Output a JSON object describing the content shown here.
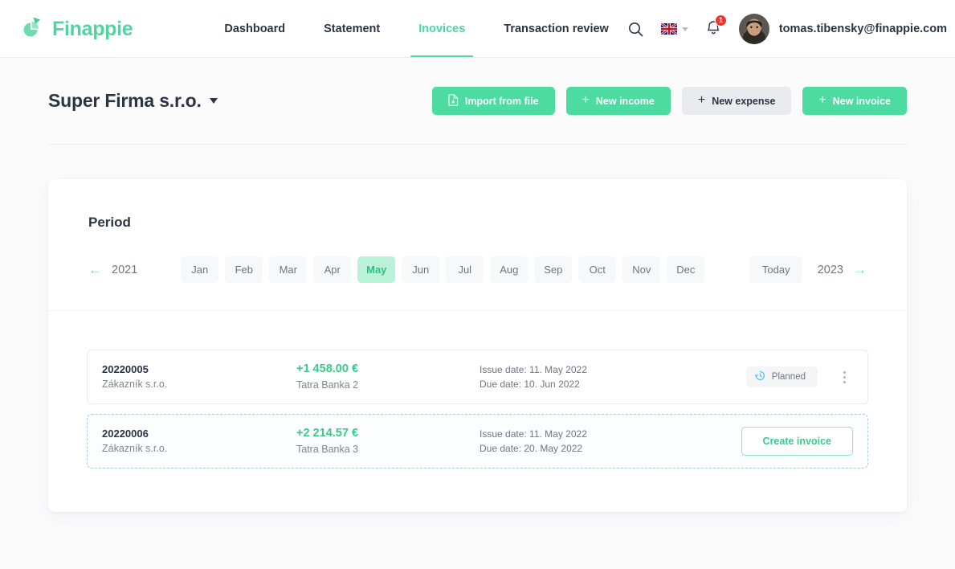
{
  "header": {
    "brand": "Finappie",
    "logo_icon": "pie-chart-logo-icon",
    "nav": [
      {
        "label": "Dashboard",
        "active": false
      },
      {
        "label": "Statement",
        "active": false
      },
      {
        "label": "Inovices",
        "active": true
      },
      {
        "label": "Transaction review",
        "active": false
      }
    ],
    "search_icon": "search-icon",
    "language": {
      "flag": "uk-flag-icon",
      "caret": "chevron-down-icon"
    },
    "notifications": {
      "icon": "bell-icon",
      "count": "1"
    },
    "user": {
      "avatar": "user-avatar",
      "email": "tomas.tibensky@finappie.com"
    }
  },
  "title_row": {
    "company": "Super Firma s.r.o.",
    "caret": "caret-down-icon",
    "buttons": [
      {
        "label": "Import from file",
        "icon": "file-import-icon",
        "style": "green"
      },
      {
        "label": "New income",
        "icon": "plus-icon",
        "style": "green"
      },
      {
        "label": "New expense",
        "icon": "plus-icon",
        "style": "grey"
      },
      {
        "label": "New invoice",
        "icon": "plus-icon",
        "style": "green"
      }
    ]
  },
  "period": {
    "label": "Period",
    "prev_year": "2021",
    "next_year": "2023",
    "prev_arrow": "arrow-left-icon",
    "next_arrow": "arrow-right-icon",
    "months": [
      "Jan",
      "Feb",
      "Mar",
      "Apr",
      "May",
      "Jun",
      "Jul",
      "Aug",
      "Sep",
      "Oct",
      "Nov",
      "Dec"
    ],
    "selected_month": "May",
    "today_label": "Today"
  },
  "invoices": [
    {
      "number": "20220005",
      "customer": "Zákazník s.r.o.",
      "amount": "+1 458.00 €",
      "bank": "Tatra Banka 2",
      "issue_date": "Issue date: 11. May 2022",
      "due_date": "Due date: 10. Jun 2022",
      "action_type": "status",
      "status_label": "Planned",
      "status_icon": "history-clock-icon",
      "menu_icon": "kebab-menu-icon"
    },
    {
      "number": "20220006",
      "customer": "Zákazník s.r.o.",
      "amount": "+2 214.57 €",
      "bank": "Tatra Banka 3",
      "issue_date": "Issue date: 11. May 2022",
      "due_date": "Due date: 20. May 2022",
      "action_type": "button",
      "button_label": "Create invoice"
    }
  ],
  "colors": {
    "accent_green": "#4ddba1",
    "amount_green": "#3cc98c",
    "month_selected_bg": "#b9f2d8",
    "badge_red": "#e8362e",
    "status_blue": "#5bb8e8"
  }
}
